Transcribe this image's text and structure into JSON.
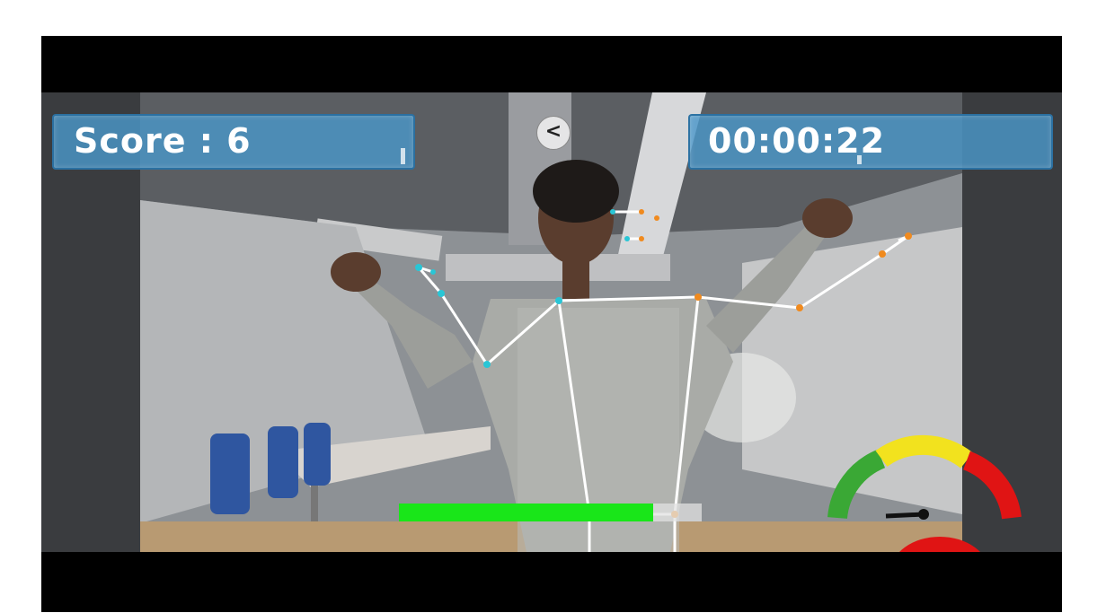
{
  "hud": {
    "score_text": "Score : 6",
    "timer_text": "00:00:22",
    "back_symbol": "<"
  },
  "game": {
    "score": 6,
    "elapsed": "00:00:22",
    "progress_fraction": 0.84,
    "speed_gauge": {
      "zones": [
        "green",
        "yellow",
        "red"
      ],
      "colors": {
        "green": "#3aa835",
        "yellow": "#f2e21e",
        "red": "#e01414"
      },
      "needle_level": 0.0
    }
  },
  "colors": {
    "hud_panel": "#4a96c8",
    "progress_fill": "#19e619",
    "skeleton_line": "#ffffff",
    "joint_left": "#29c6d6",
    "joint_right": "#f08a1e"
  }
}
